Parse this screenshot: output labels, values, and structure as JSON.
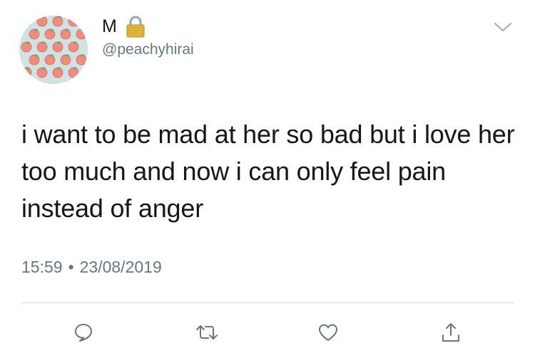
{
  "tweet": {
    "display_name": "M",
    "handle": "@peachyhirai",
    "text": "i want to be mad at her so bad but i love her too much and now i can only feel pain instead of anger",
    "time": "15:59",
    "separator": "•",
    "date": "23/08/2019"
  },
  "icons": {
    "avatar": "peach-pattern-avatar",
    "lock": "lock-icon",
    "menu": "chevron-down-icon",
    "reply": "reply-icon",
    "retweet": "retweet-icon",
    "like": "heart-icon",
    "share": "share-icon"
  },
  "colors": {
    "text": "#14171a",
    "secondary": "#657786",
    "divider": "#ccd6dd",
    "avatar_bg": "#cfe3e4",
    "peach": "#f08c7d",
    "lock_gold": "#e2b53c"
  }
}
